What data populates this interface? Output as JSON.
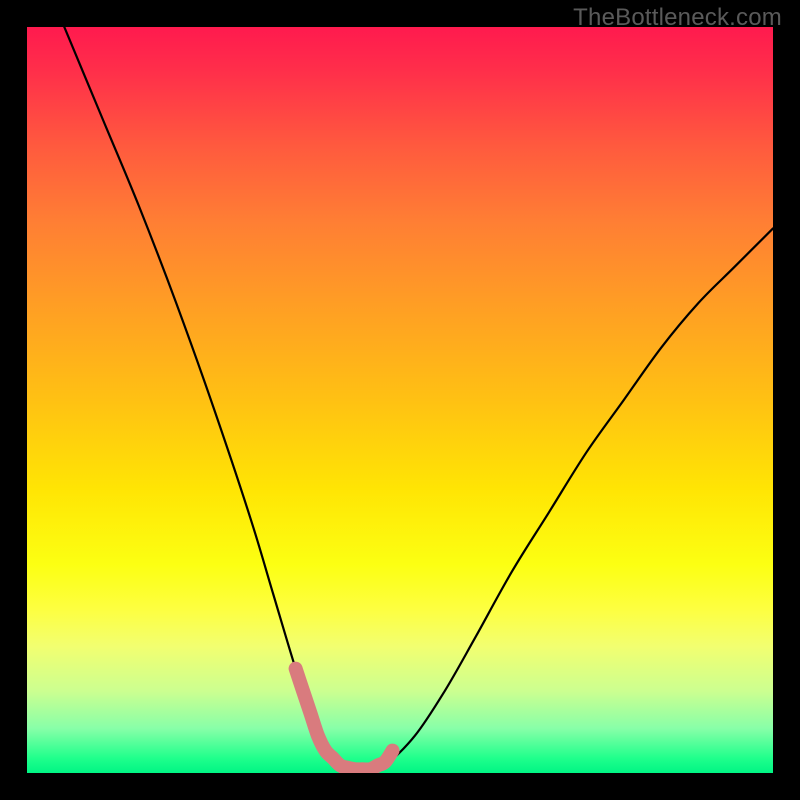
{
  "watermark": "TheBottleneck.com",
  "chart_data": {
    "type": "line",
    "title": "",
    "xlabel": "",
    "ylabel": "",
    "xlim": [
      0,
      100
    ],
    "ylim": [
      0,
      100
    ],
    "series": [
      {
        "name": "bottleneck-curve",
        "x": [
          5,
          10,
          15,
          20,
          25,
          30,
          33,
          36,
          38,
          40,
          42,
          44,
          46,
          48,
          52,
          56,
          60,
          65,
          70,
          75,
          80,
          85,
          90,
          95,
          100
        ],
        "y": [
          100,
          88,
          76,
          63,
          49,
          34,
          24,
          14,
          8,
          3,
          1,
          0.5,
          0.5,
          1,
          5,
          11,
          18,
          27,
          35,
          43,
          50,
          57,
          63,
          68,
          73
        ]
      }
    ],
    "highlight": {
      "name": "optimal-range",
      "color": "#d97b7e",
      "x": [
        36,
        37,
        38,
        39,
        40,
        41,
        42,
        43,
        44,
        45,
        46,
        47,
        48,
        49
      ],
      "y": [
        14,
        11,
        8,
        5,
        3,
        2,
        1,
        0.7,
        0.5,
        0.5,
        0.5,
        1,
        1.5,
        3
      ]
    },
    "background_gradient": {
      "top_color": "#ff1a4e",
      "bottom_color": "#00f584",
      "meaning": "red=high bottleneck, green=low bottleneck"
    }
  }
}
